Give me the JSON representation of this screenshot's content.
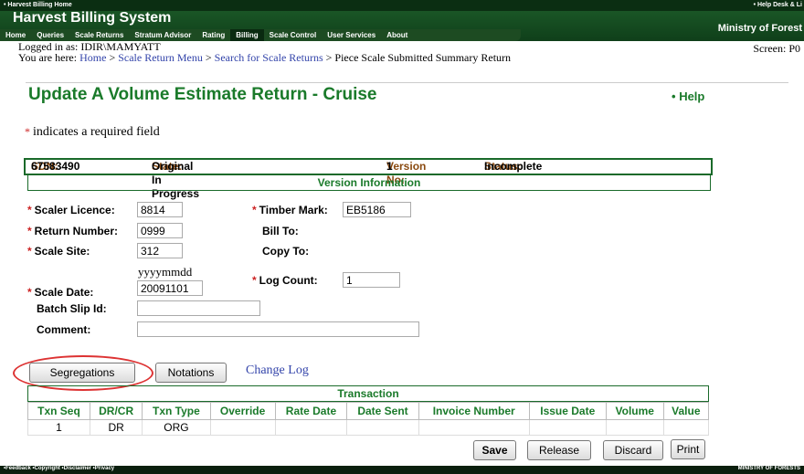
{
  "header": {
    "top_left": "• Harvest Billing Home",
    "top_right": "• Help Desk & Li",
    "app_title": "Harvest Billing System",
    "ministry": "Ministry of Forest",
    "screen_id": "Screen: P0"
  },
  "nav": {
    "tabs": [
      {
        "label": "Home"
      },
      {
        "label": "Queries"
      },
      {
        "label": "Scale Returns"
      },
      {
        "label": "Stratum Advisor"
      },
      {
        "label": "Rating"
      },
      {
        "label": "Billing"
      },
      {
        "label": "Scale Control"
      },
      {
        "label": "User Services"
      },
      {
        "label": "About"
      }
    ]
  },
  "user": {
    "logged_in": "Logged in as: IDIR\\MAMYATT"
  },
  "breadcrumb": {
    "prefix": "You are here:",
    "items": [
      "Home",
      "Scale Return Menu",
      "Search for Scale Returns"
    ],
    "current": "Piece Scale Submitted Summary Return",
    "sep": ">"
  },
  "page": {
    "title": "Update A Volume Estimate Return - Cruise",
    "help": "Help",
    "required_note": "indicates a required field"
  },
  "summary": {
    "sdn_label": "SDN:",
    "sdn": "67583490",
    "state_label": "State:",
    "state": "Original In Progress",
    "version_label": "Version No:",
    "version": "1",
    "status_label": "Status:",
    "status": "Incomplete"
  },
  "version_info": {
    "header": "Version Information",
    "scaler_licence_label": "Scaler Licence:",
    "scaler_licence": "8814",
    "return_number_label": "Return Number:",
    "return_number": "0999",
    "scale_site_label": "Scale Site:",
    "scale_site": "312",
    "date_format": "yyyymmdd",
    "scale_date_label": "Scale Date:",
    "scale_date": "20091101",
    "batch_slip_label": "Batch Slip Id:",
    "batch_slip": "",
    "comment_label": "Comment:",
    "comment": "",
    "timber_mark_label": "Timber Mark:",
    "timber_mark": "EB5186",
    "bill_to_label": "Bill To:",
    "copy_to_label": "Copy To:",
    "log_count_label": "Log Count:",
    "log_count": "1"
  },
  "actions": {
    "segregations": "Segregations",
    "notations": "Notations",
    "change_log": "Change Log",
    "save": "Save",
    "release": "Release",
    "discard": "Discard",
    "print": "Print"
  },
  "transaction": {
    "header": "Transaction",
    "columns": [
      "Txn Seq",
      "DR/CR",
      "Txn Type",
      "Override",
      "Rate Date",
      "Date Sent",
      "Invoice Number",
      "Issue Date",
      "Volume",
      "Value"
    ],
    "rows": [
      [
        "1",
        "DR",
        "ORG",
        "",
        "",
        "",
        "",
        "",
        "",
        ""
      ]
    ]
  },
  "footer": {
    "links": "•Feedback •Copyright •Disclaimer •Privacy",
    "right": "MINISTRY OF FORESTS"
  }
}
